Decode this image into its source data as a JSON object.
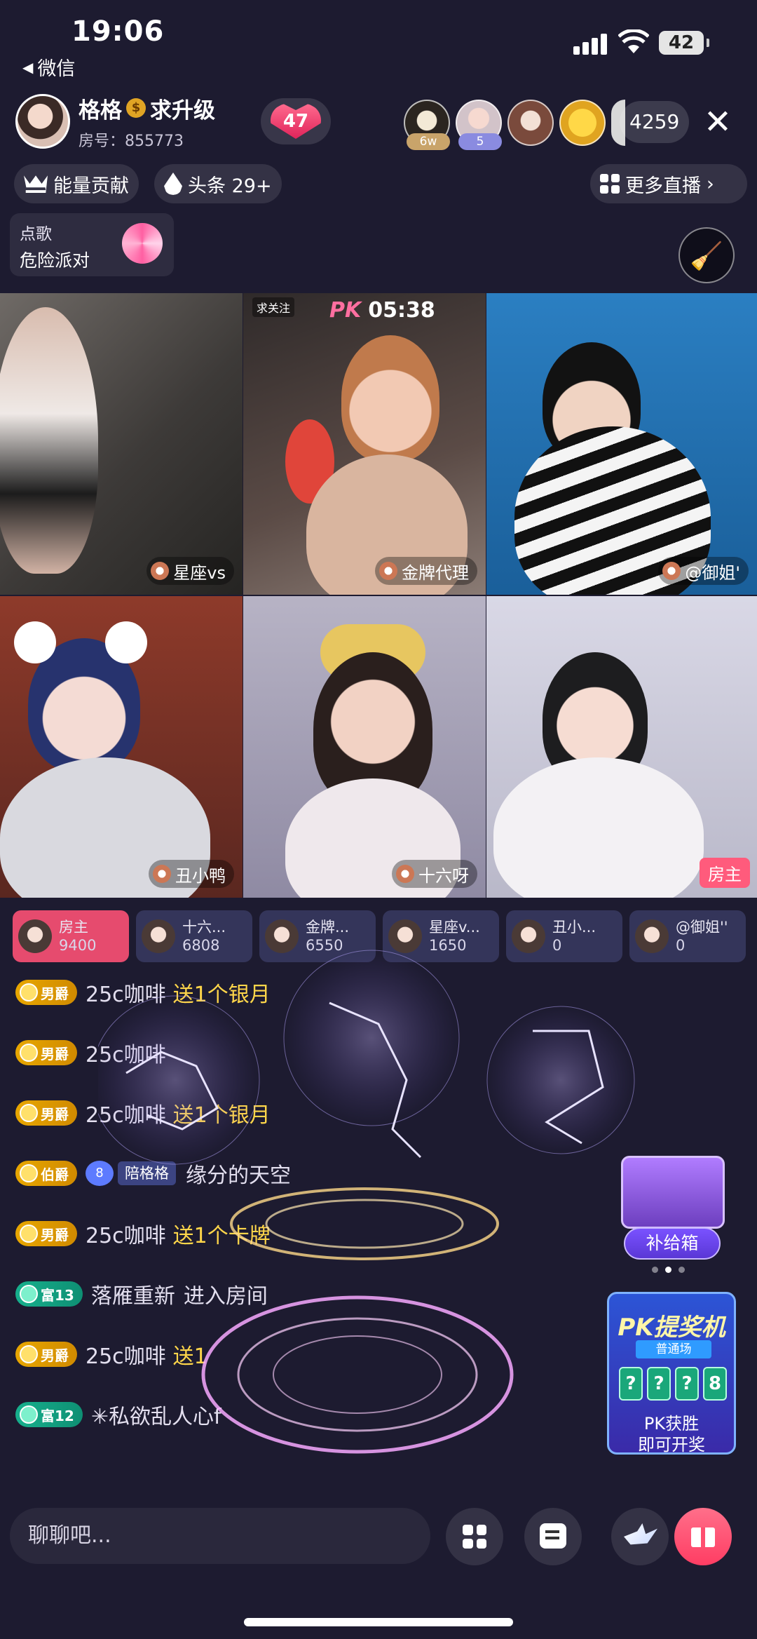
{
  "status_bar": {
    "time": "19:06",
    "back_app": "微信",
    "battery": "42"
  },
  "room": {
    "host_name": "格格",
    "host_suffix": "求升级",
    "room_no": "房号：855773",
    "heart_count": "47",
    "viewer_count": "4259",
    "viewer_tags": [
      "6w",
      "5"
    ]
  },
  "chips": {
    "energy": "能量贡献",
    "headline": "头条 29+",
    "more_live": "更多直播"
  },
  "song": {
    "line1": "点歌",
    "line2": "危险派对"
  },
  "pk": {
    "label": "PK",
    "timer": "05:38",
    "follow": "求关注"
  },
  "tiles": [
    {
      "label": "星座vs"
    },
    {
      "label": "金牌代理"
    },
    {
      "label": "@御姐'"
    },
    {
      "label": "丑小鸭"
    },
    {
      "label": "十六呀"
    },
    {
      "label": "房主"
    }
  ],
  "scores": [
    {
      "name": "房主",
      "value": "9400"
    },
    {
      "name": "十六...",
      "value": "6808"
    },
    {
      "name": "金牌...",
      "value": "6550"
    },
    {
      "name": "星座v...",
      "value": "1650"
    },
    {
      "name": "丑小...",
      "value": "0"
    },
    {
      "name": "@御姐''",
      "value": "0"
    }
  ],
  "chat": [
    {
      "badge": "男爵",
      "name": "25c咖啡",
      "action": "送1个银月"
    },
    {
      "badge": "男爵",
      "name": "25c咖啡",
      "action": ""
    },
    {
      "badge": "男爵",
      "name": "25c咖啡",
      "action": "送1个银月"
    },
    {
      "badge": "伯爵",
      "level": "8",
      "fan": "陪格格",
      "name": "缘分的天空",
      "action": ""
    },
    {
      "badge": "男爵",
      "name": "25c咖啡",
      "action": "送1个卡牌"
    },
    {
      "badge": "富13",
      "name": "落雁重新",
      "action": "进入房间"
    },
    {
      "badge": "男爵",
      "name": "25c咖啡",
      "action": "送1"
    },
    {
      "badge": "富12",
      "name": "✳私欲乱人心f",
      "action": ""
    }
  ],
  "supply": {
    "label": "补给箱"
  },
  "promo": {
    "title": "PK提奖机",
    "sub": "普通场",
    "slots": [
      "?",
      "?",
      "?",
      "8"
    ],
    "foot1": "PK获胜",
    "foot2": "即可开奖"
  },
  "input": {
    "placeholder": "聊聊吧..."
  }
}
